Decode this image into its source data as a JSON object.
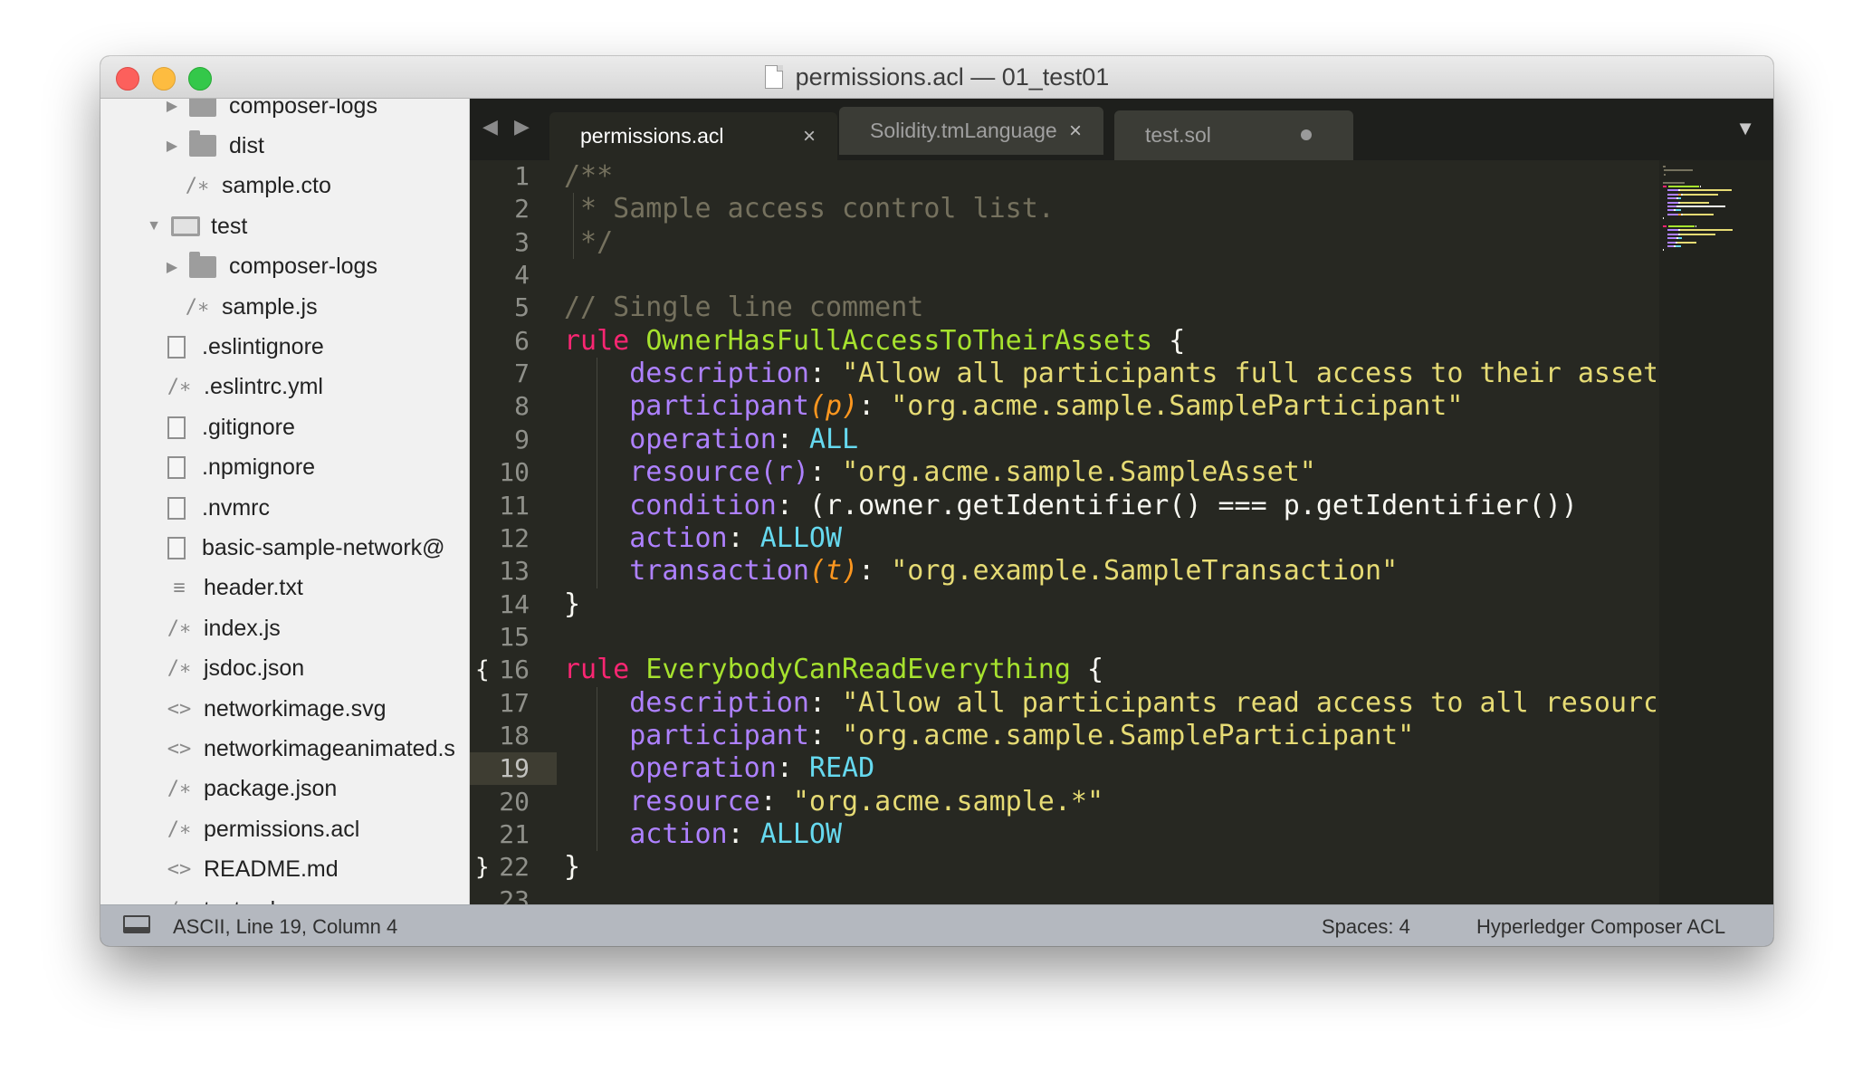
{
  "window": {
    "title": "permissions.acl — 01_test01"
  },
  "sidebar": {
    "items": [
      {
        "label": "composer-logs",
        "type": "folder",
        "indent": 2
      },
      {
        "label": "dist",
        "type": "folder",
        "indent": 2
      },
      {
        "label": "sample.cto",
        "type": "comment-file",
        "indent": 2
      },
      {
        "label": "test",
        "type": "folder-open",
        "indent": 1
      },
      {
        "label": "composer-logs",
        "type": "folder",
        "indent": 2
      },
      {
        "label": "sample.js",
        "type": "comment-file",
        "indent": 2
      },
      {
        "label": ".eslintignore",
        "type": "file",
        "indent": 1
      },
      {
        "label": ".eslintrc.yml",
        "type": "comment-file",
        "indent": 1
      },
      {
        "label": ".gitignore",
        "type": "file",
        "indent": 1
      },
      {
        "label": ".npmignore",
        "type": "file",
        "indent": 1
      },
      {
        "label": ".nvmrc",
        "type": "file",
        "indent": 1
      },
      {
        "label": "basic-sample-network@",
        "type": "file",
        "indent": 1
      },
      {
        "label": "header.txt",
        "type": "text-file",
        "indent": 1
      },
      {
        "label": "index.js",
        "type": "comment-file",
        "indent": 1
      },
      {
        "label": "jsdoc.json",
        "type": "comment-file",
        "indent": 1
      },
      {
        "label": "networkimage.svg",
        "type": "markup-file",
        "indent": 1
      },
      {
        "label": "networkimageanimated.s",
        "type": "markup-file",
        "indent": 1
      },
      {
        "label": "package.json",
        "type": "comment-file",
        "indent": 1
      },
      {
        "label": "permissions.acl",
        "type": "comment-file",
        "indent": 1
      },
      {
        "label": "README.md",
        "type": "markup-file",
        "indent": 1
      },
      {
        "label": "test.sol",
        "type": "comment-file",
        "indent": 1
      }
    ],
    "icons": {
      "comment-file": "/∗",
      "markup-file": "<>",
      "text-file": "≡"
    }
  },
  "tabs": {
    "nav": "◀ ▶",
    "active": {
      "label": "permissions.acl",
      "close": "×"
    },
    "second": {
      "label": "Solidity.tmLanguage",
      "close": "×"
    },
    "third": {
      "label": "test.sol"
    },
    "dropdown": "▼"
  },
  "editor": {
    "line_numbers": [
      "1",
      "2",
      "3",
      "4",
      "5",
      "6",
      "7",
      "8",
      "9",
      "10",
      "11",
      "12",
      "13",
      "14",
      "15",
      "16",
      "17",
      "18",
      "19",
      "20",
      "21",
      "22",
      "23"
    ],
    "current_line": 19,
    "fold_markers": [
      {
        "line": 16,
        "glyph": "{"
      },
      {
        "line": 22,
        "glyph": "}"
      }
    ],
    "lines": [
      [
        {
          "t": "/**",
          "c": "comment"
        }
      ],
      [
        {
          "t": " * Sample access control list.",
          "c": "comment"
        }
      ],
      [
        {
          "t": " */",
          "c": "comment"
        }
      ],
      [],
      [
        {
          "t": "// Single line comment",
          "c": "comment"
        }
      ],
      [
        {
          "t": "rule",
          "c": "kw"
        },
        {
          "t": " ",
          "c": "plain"
        },
        {
          "t": "OwnerHasFullAccessToTheirAssets",
          "c": "name"
        },
        {
          "t": " {",
          "c": "plain"
        }
      ],
      [
        {
          "t": "    ",
          "c": "plain"
        },
        {
          "t": "description",
          "c": "prop"
        },
        {
          "t": ": ",
          "c": "plain"
        },
        {
          "t": "\"Allow all participants full access to their assets\"",
          "c": "str"
        }
      ],
      [
        {
          "t": "    ",
          "c": "plain"
        },
        {
          "t": "participant",
          "c": "prop"
        },
        {
          "t": "(p)",
          "c": "var"
        },
        {
          "t": ": ",
          "c": "plain"
        },
        {
          "t": "\"org.acme.sample.SampleParticipant\"",
          "c": "str"
        }
      ],
      [
        {
          "t": "    ",
          "c": "plain"
        },
        {
          "t": "operation",
          "c": "prop"
        },
        {
          "t": ": ",
          "c": "plain"
        },
        {
          "t": "ALL",
          "c": "const"
        }
      ],
      [
        {
          "t": "    ",
          "c": "plain"
        },
        {
          "t": "resource",
          "c": "prop"
        },
        {
          "t": "(r)",
          "c": "prop"
        },
        {
          "t": ": ",
          "c": "plain"
        },
        {
          "t": "\"org.acme.sample.SampleAsset\"",
          "c": "str"
        }
      ],
      [
        {
          "t": "    ",
          "c": "plain"
        },
        {
          "t": "condition",
          "c": "prop"
        },
        {
          "t": ": (r.owner.getIdentifier() === p.getIdentifier())",
          "c": "plain"
        }
      ],
      [
        {
          "t": "    ",
          "c": "plain"
        },
        {
          "t": "action",
          "c": "prop"
        },
        {
          "t": ": ",
          "c": "plain"
        },
        {
          "t": "ALLOW",
          "c": "const"
        }
      ],
      [
        {
          "t": "    ",
          "c": "plain"
        },
        {
          "t": "transaction",
          "c": "prop"
        },
        {
          "t": "(t)",
          "c": "var"
        },
        {
          "t": ": ",
          "c": "plain"
        },
        {
          "t": "\"org.example.SampleTransaction\"",
          "c": "str"
        }
      ],
      [
        {
          "t": "}",
          "c": "plain"
        }
      ],
      [],
      [
        {
          "t": "rule",
          "c": "kw"
        },
        {
          "t": " ",
          "c": "plain"
        },
        {
          "t": "EverybodyCanReadEverything",
          "c": "name"
        },
        {
          "t": " {",
          "c": "plain"
        }
      ],
      [
        {
          "t": "    ",
          "c": "plain"
        },
        {
          "t": "description",
          "c": "prop"
        },
        {
          "t": ": ",
          "c": "plain"
        },
        {
          "t": "\"Allow all participants read access to all resources\"",
          "c": "str"
        }
      ],
      [
        {
          "t": "    ",
          "c": "plain"
        },
        {
          "t": "participant",
          "c": "prop"
        },
        {
          "t": ": ",
          "c": "plain"
        },
        {
          "t": "\"org.acme.sample.SampleParticipant\"",
          "c": "str"
        }
      ],
      [
        {
          "t": "    ",
          "c": "plain"
        },
        {
          "t": "operation",
          "c": "prop"
        },
        {
          "t": ": ",
          "c": "plain"
        },
        {
          "t": "READ",
          "c": "const"
        }
      ],
      [
        {
          "t": "    ",
          "c": "plain"
        },
        {
          "t": "resource",
          "c": "prop"
        },
        {
          "t": ": ",
          "c": "plain"
        },
        {
          "t": "\"org.acme.sample.*\"",
          "c": "str"
        }
      ],
      [
        {
          "t": "    ",
          "c": "plain"
        },
        {
          "t": "action",
          "c": "prop"
        },
        {
          "t": ": ",
          "c": "plain"
        },
        {
          "t": "ALLOW",
          "c": "const"
        }
      ],
      [
        {
          "t": "}",
          "c": "plain"
        }
      ],
      []
    ]
  },
  "statusbar": {
    "position": "ASCII, Line 19, Column 4",
    "spaces": "Spaces: 4",
    "syntax": "Hyperledger Composer ACL"
  },
  "colors": {
    "editor_bg": "#272822",
    "keyword": "#f92672",
    "name": "#a6e22e",
    "property": "#ae81ff",
    "string": "#e6db74",
    "constant": "#66d9ef",
    "variable": "#fd971f",
    "comment": "#75715e"
  }
}
